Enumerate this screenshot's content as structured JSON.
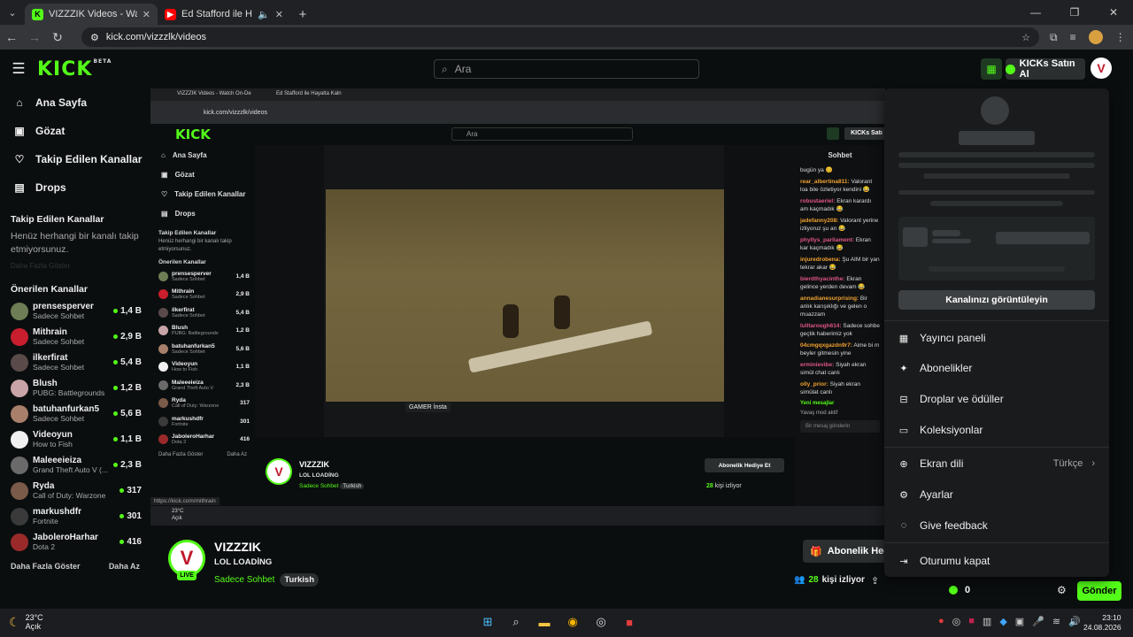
{
  "browser": {
    "tabs": [
      {
        "title": "VIZZZIK Videos - Watch On-De",
        "active": true,
        "favicon": "kick-favicon",
        "color": "#53fc18"
      },
      {
        "title": "Ed Stafford ile Hayatta Kaln",
        "active": false,
        "favicon": "youtube-favicon",
        "color": "#ff0000"
      }
    ],
    "url": "kick.com/vizzzlk/videos"
  },
  "kick": {
    "logo": "KICK",
    "logo_beta": "BETA",
    "search_placeholder": "Ara",
    "kicks_button": "KICKs Satın Al",
    "avatar_letter": "V"
  },
  "sidebar": {
    "nav": [
      {
        "label": "Ana Sayfa",
        "icon": "home-icon"
      },
      {
        "label": "Gözat",
        "icon": "browse-icon"
      },
      {
        "label": "Takip Edilen Kanallar",
        "icon": "heart-icon"
      },
      {
        "label": "Drops",
        "icon": "drops-icon"
      }
    ],
    "followed_title": "Takip Edilen Kanallar",
    "followed_empty": "Henüz herhangi bir kanalı takip etmiyorsunuz.",
    "followed_more": "Daha Fazla Göster",
    "recommended_title": "Önerilen Kanallar",
    "channels": [
      {
        "name": "prensesperver",
        "category": "Sadece Sohbet",
        "viewers": "1,4 B",
        "color": "#6e7d55"
      },
      {
        "name": "Mithrain",
        "category": "Sadece Sohbet",
        "viewers": "2,9 B",
        "color": "#c81e2d"
      },
      {
        "name": "ilkerfirat",
        "category": "Sadece Sohbet",
        "viewers": "5,4 B",
        "color": "#5a4a4a"
      },
      {
        "name": "Blush",
        "category": "PUBG: Battlegrounds",
        "viewers": "1,2 B",
        "color": "#c8a4a8"
      },
      {
        "name": "batuhanfurkan5",
        "category": "Sadece Sohbet",
        "viewers": "5,6 B",
        "color": "#a77f6a"
      },
      {
        "name": "Videoyun",
        "category": "How to Fish",
        "viewers": "1,1 B",
        "color": "#f0f0f0"
      },
      {
        "name": "Maleeeieiza",
        "category": "Grand Theft Auto V (...",
        "viewers": "2,3 B",
        "color": "#6a6a6a"
      },
      {
        "name": "Ryda",
        "category": "Call of Duty: Warzone",
        "viewers": "317",
        "color": "#7a5a48"
      },
      {
        "name": "markushdfr",
        "category": "Fortnite",
        "viewers": "301",
        "color": "#3a3a3a"
      },
      {
        "name": "JaboleroHarhar",
        "category": "Dota 2",
        "viewers": "416",
        "color": "#9a2a2a"
      }
    ],
    "more_label": "Daha Fazla Göster",
    "less_label": "Daha Az"
  },
  "stream": {
    "streamer": "VIZZZIK",
    "title": "LOL LOADİNG",
    "category": "Sadece Sohbet",
    "tag": "Turkish",
    "live_badge": "LIVE",
    "gift_button": "Abonelik Hediye Et",
    "watchers_count": "28",
    "watchers_label": "kişi izliyor"
  },
  "inner_stream": {
    "url": "kick.com/vizzzlk/videos",
    "tab1": "VIZZZIK Videos - Watch On-De",
    "tab2": "Ed Stafford ile Hayatta Kaln",
    "search": "Ara",
    "kicks": "KICKs Satı",
    "chat_header": "Sohbet",
    "tooltip": "GAMER İnsta",
    "url_hint": "https://kick.com/mithrain",
    "new_messages": "Yeni mesajlar",
    "chat_placeholder": "Bir mesaj gönderin",
    "chat_count": "0",
    "slow_mode": "Yavaş mod aktif",
    "weather_temp": "23°C",
    "weather_desc": "Açık",
    "messages": [
      {
        "user": "",
        "text": "bugün ya 😊"
      },
      {
        "user": "rear_albertina811:",
        "text": "Valorant loa bile özletiyor kendini 😂"
      },
      {
        "user": "robustaeriel:",
        "text": "Ekran karardı am kaçmadık 😂"
      },
      {
        "user": "jadefanny208:",
        "text": "Valorant yerine izliyoruz şu an 😂"
      },
      {
        "user": "phyllys_parliament:",
        "text": "Ekran kar kaçmadık 😂"
      },
      {
        "user": "injuredrobena:",
        "text": "Şu AIM bir yan tekrar akar 😂"
      },
      {
        "user": "bierdthyacinthe:",
        "text": "Ekran gelince yerden devam 😂"
      },
      {
        "user": "annadianesurprising:",
        "text": "Bir anlık karışıklığı ve gelen o muazzam"
      },
      {
        "user": "lulltarough614:",
        "text": "Sadece sohbe geçtik haberimiz yok"
      },
      {
        "user": "04cmgqxgazdn9r7:",
        "text": "Aime bi m beyler gitmesin yine"
      },
      {
        "user": "erminievibe:",
        "text": "Siyah ekran simül chat canlı"
      },
      {
        "user": "olly_prior:",
        "text": "Siyah ekran simülat canlı"
      }
    ],
    "channels": [
      {
        "name": "prensesperver",
        "category": "Sadece Sohbet",
        "viewers": "1,4 B",
        "color": "#6e7d55"
      },
      {
        "name": "Mithrain",
        "category": "Sadece Sohbet",
        "viewers": "2,9 B",
        "color": "#c81e2d"
      },
      {
        "name": "ilkerfirat",
        "category": "Sadece Sohbet",
        "viewers": "5,4 B",
        "color": "#5a4a4a"
      },
      {
        "name": "Blush",
        "category": "PUBG: Battlegrounds",
        "viewers": "1,2 B",
        "color": "#c8a4a8"
      },
      {
        "name": "batuhanfurkan5",
        "category": "Sadece Sohbet",
        "viewers": "5,6 B",
        "color": "#a77f6a"
      },
      {
        "name": "Videoyun",
        "category": "How to Fish",
        "viewers": "1,1 B",
        "color": "#f0f0f0"
      },
      {
        "name": "Maleeeieiza",
        "category": "Grand Theft Auto V",
        "viewers": "2,3 B",
        "color": "#6a6a6a"
      },
      {
        "name": "Ryda",
        "category": "Call of Duty: Warzone",
        "viewers": "317",
        "color": "#7a5a48"
      },
      {
        "name": "markushdfr",
        "category": "Fortnite",
        "viewers": "301",
        "color": "#3a3a3a"
      },
      {
        "name": "JaboleroHarhar",
        "category": "Dota 2",
        "viewers": "416",
        "color": "#9a2a2a"
      }
    ]
  },
  "chat": {
    "points": "0",
    "send_label": "Gönder"
  },
  "dropdown": {
    "view_channel": "Kanalınızı görüntüleyin",
    "items": [
      {
        "label": "Yayıncı paneli",
        "icon": "dashboard-icon"
      },
      {
        "label": "Abonelikler",
        "icon": "sparkle-icon"
      },
      {
        "label": "Droplar ve ödüller",
        "icon": "gift-icon"
      },
      {
        "label": "Koleksiyonlar",
        "icon": "collection-icon"
      }
    ],
    "language_label": "Ekran dili",
    "language_value": "Türkçe",
    "settings_label": "Ayarlar",
    "feedback_label": "Give feedback",
    "logout_label": "Oturumu kapat"
  },
  "taskbar": {
    "weather_temp": "23°C",
    "weather_desc": "Açık",
    "time": "23:10",
    "date": "24.08.2026"
  }
}
